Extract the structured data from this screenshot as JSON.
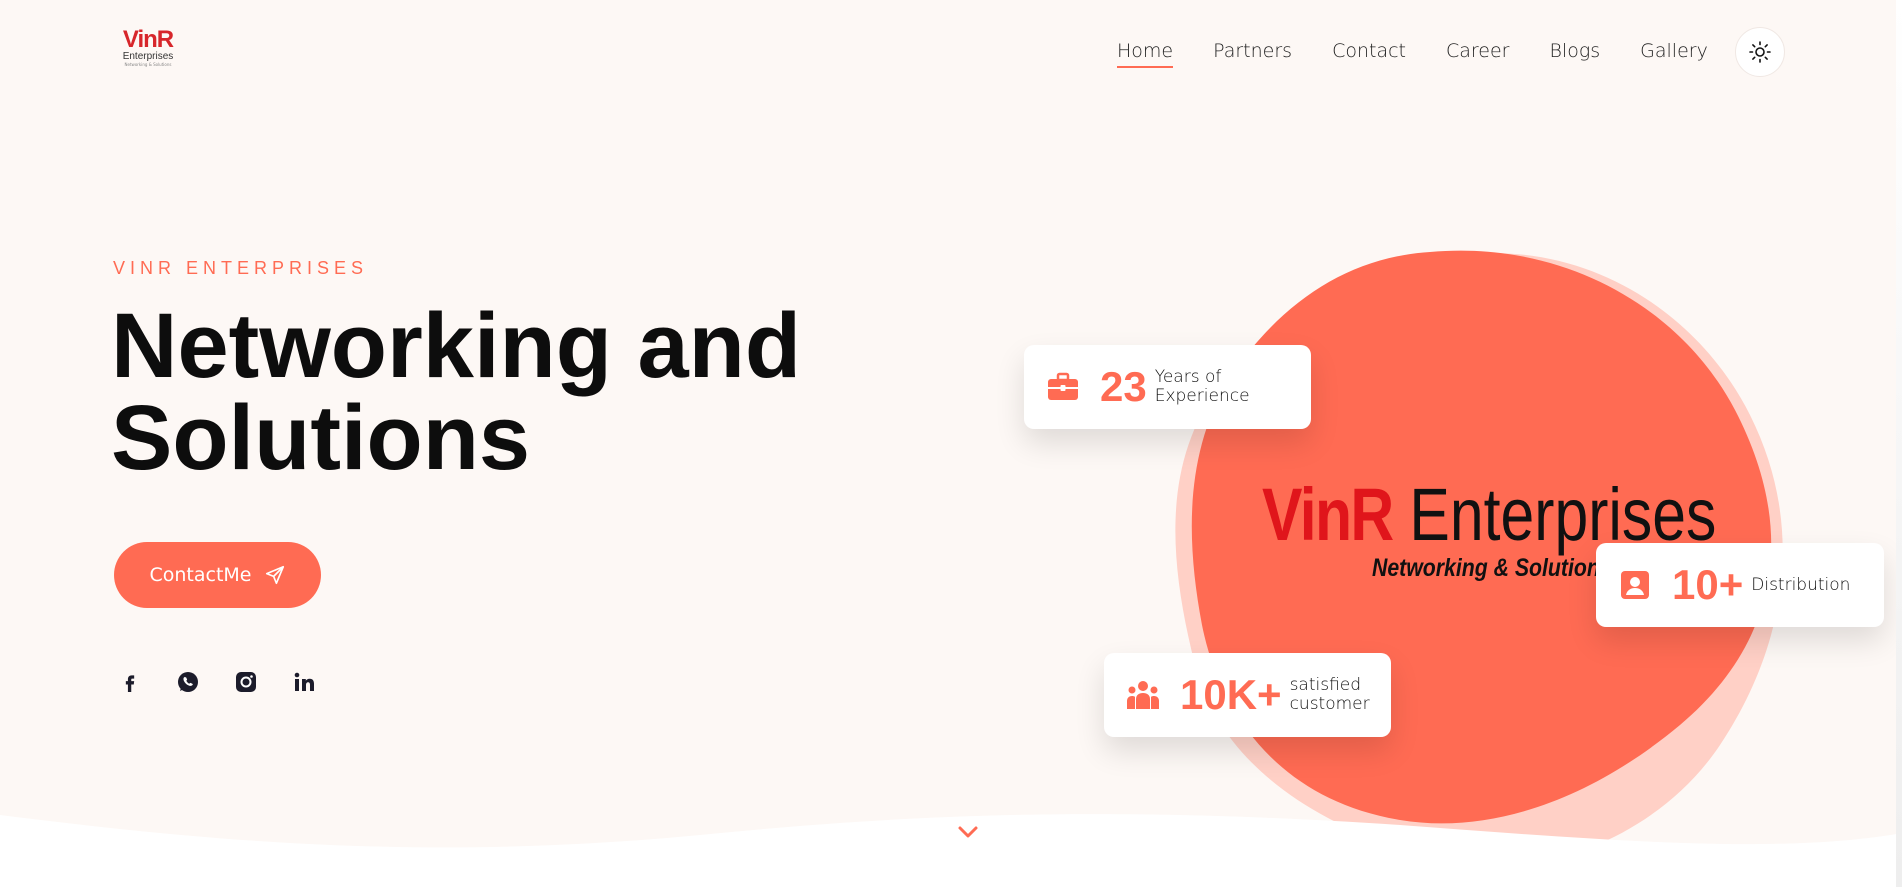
{
  "header": {
    "logo": {
      "brand": "VinR",
      "sub": "Enterprises",
      "tagline": "Networking & Solutions"
    },
    "nav": [
      {
        "label": "Home",
        "active": true
      },
      {
        "label": "Partners",
        "active": false
      },
      {
        "label": "Contact",
        "active": false
      },
      {
        "label": "Career",
        "active": false
      },
      {
        "label": "Blogs",
        "active": false
      },
      {
        "label": "Gallery",
        "active": false
      }
    ],
    "theme_toggle_icon": "sun-icon"
  },
  "hero": {
    "eyebrow": "VINR ENTERPRISES",
    "title_line1": "Networking and",
    "title_line2": "Solutions",
    "cta_label": "ContactMe",
    "cta_icon": "send-icon",
    "socials": [
      "facebook-icon",
      "whatsapp-icon",
      "instagram-icon",
      "linkedin-icon"
    ]
  },
  "showcase": {
    "logo_vinr": "VinR",
    "logo_enterprises": "Enterprises",
    "logo_tagline": "Networking & Solutions",
    "stats": {
      "experience": {
        "icon": "briefcase-icon",
        "value": "23",
        "label_line1": "Years of",
        "label_line2": "Experience"
      },
      "distribution": {
        "icon": "contact-card-icon",
        "value": "10+",
        "label_line1": "Distribution"
      },
      "customers": {
        "icon": "users-icon",
        "value": "10K+",
        "label_line1": "satisfied",
        "label_line2": "customer"
      }
    }
  },
  "colors": {
    "accent": "#ff6b53",
    "accent_light": "#ffd0c6",
    "background": "#fdf8f5",
    "brand_red": "#e0151b"
  }
}
